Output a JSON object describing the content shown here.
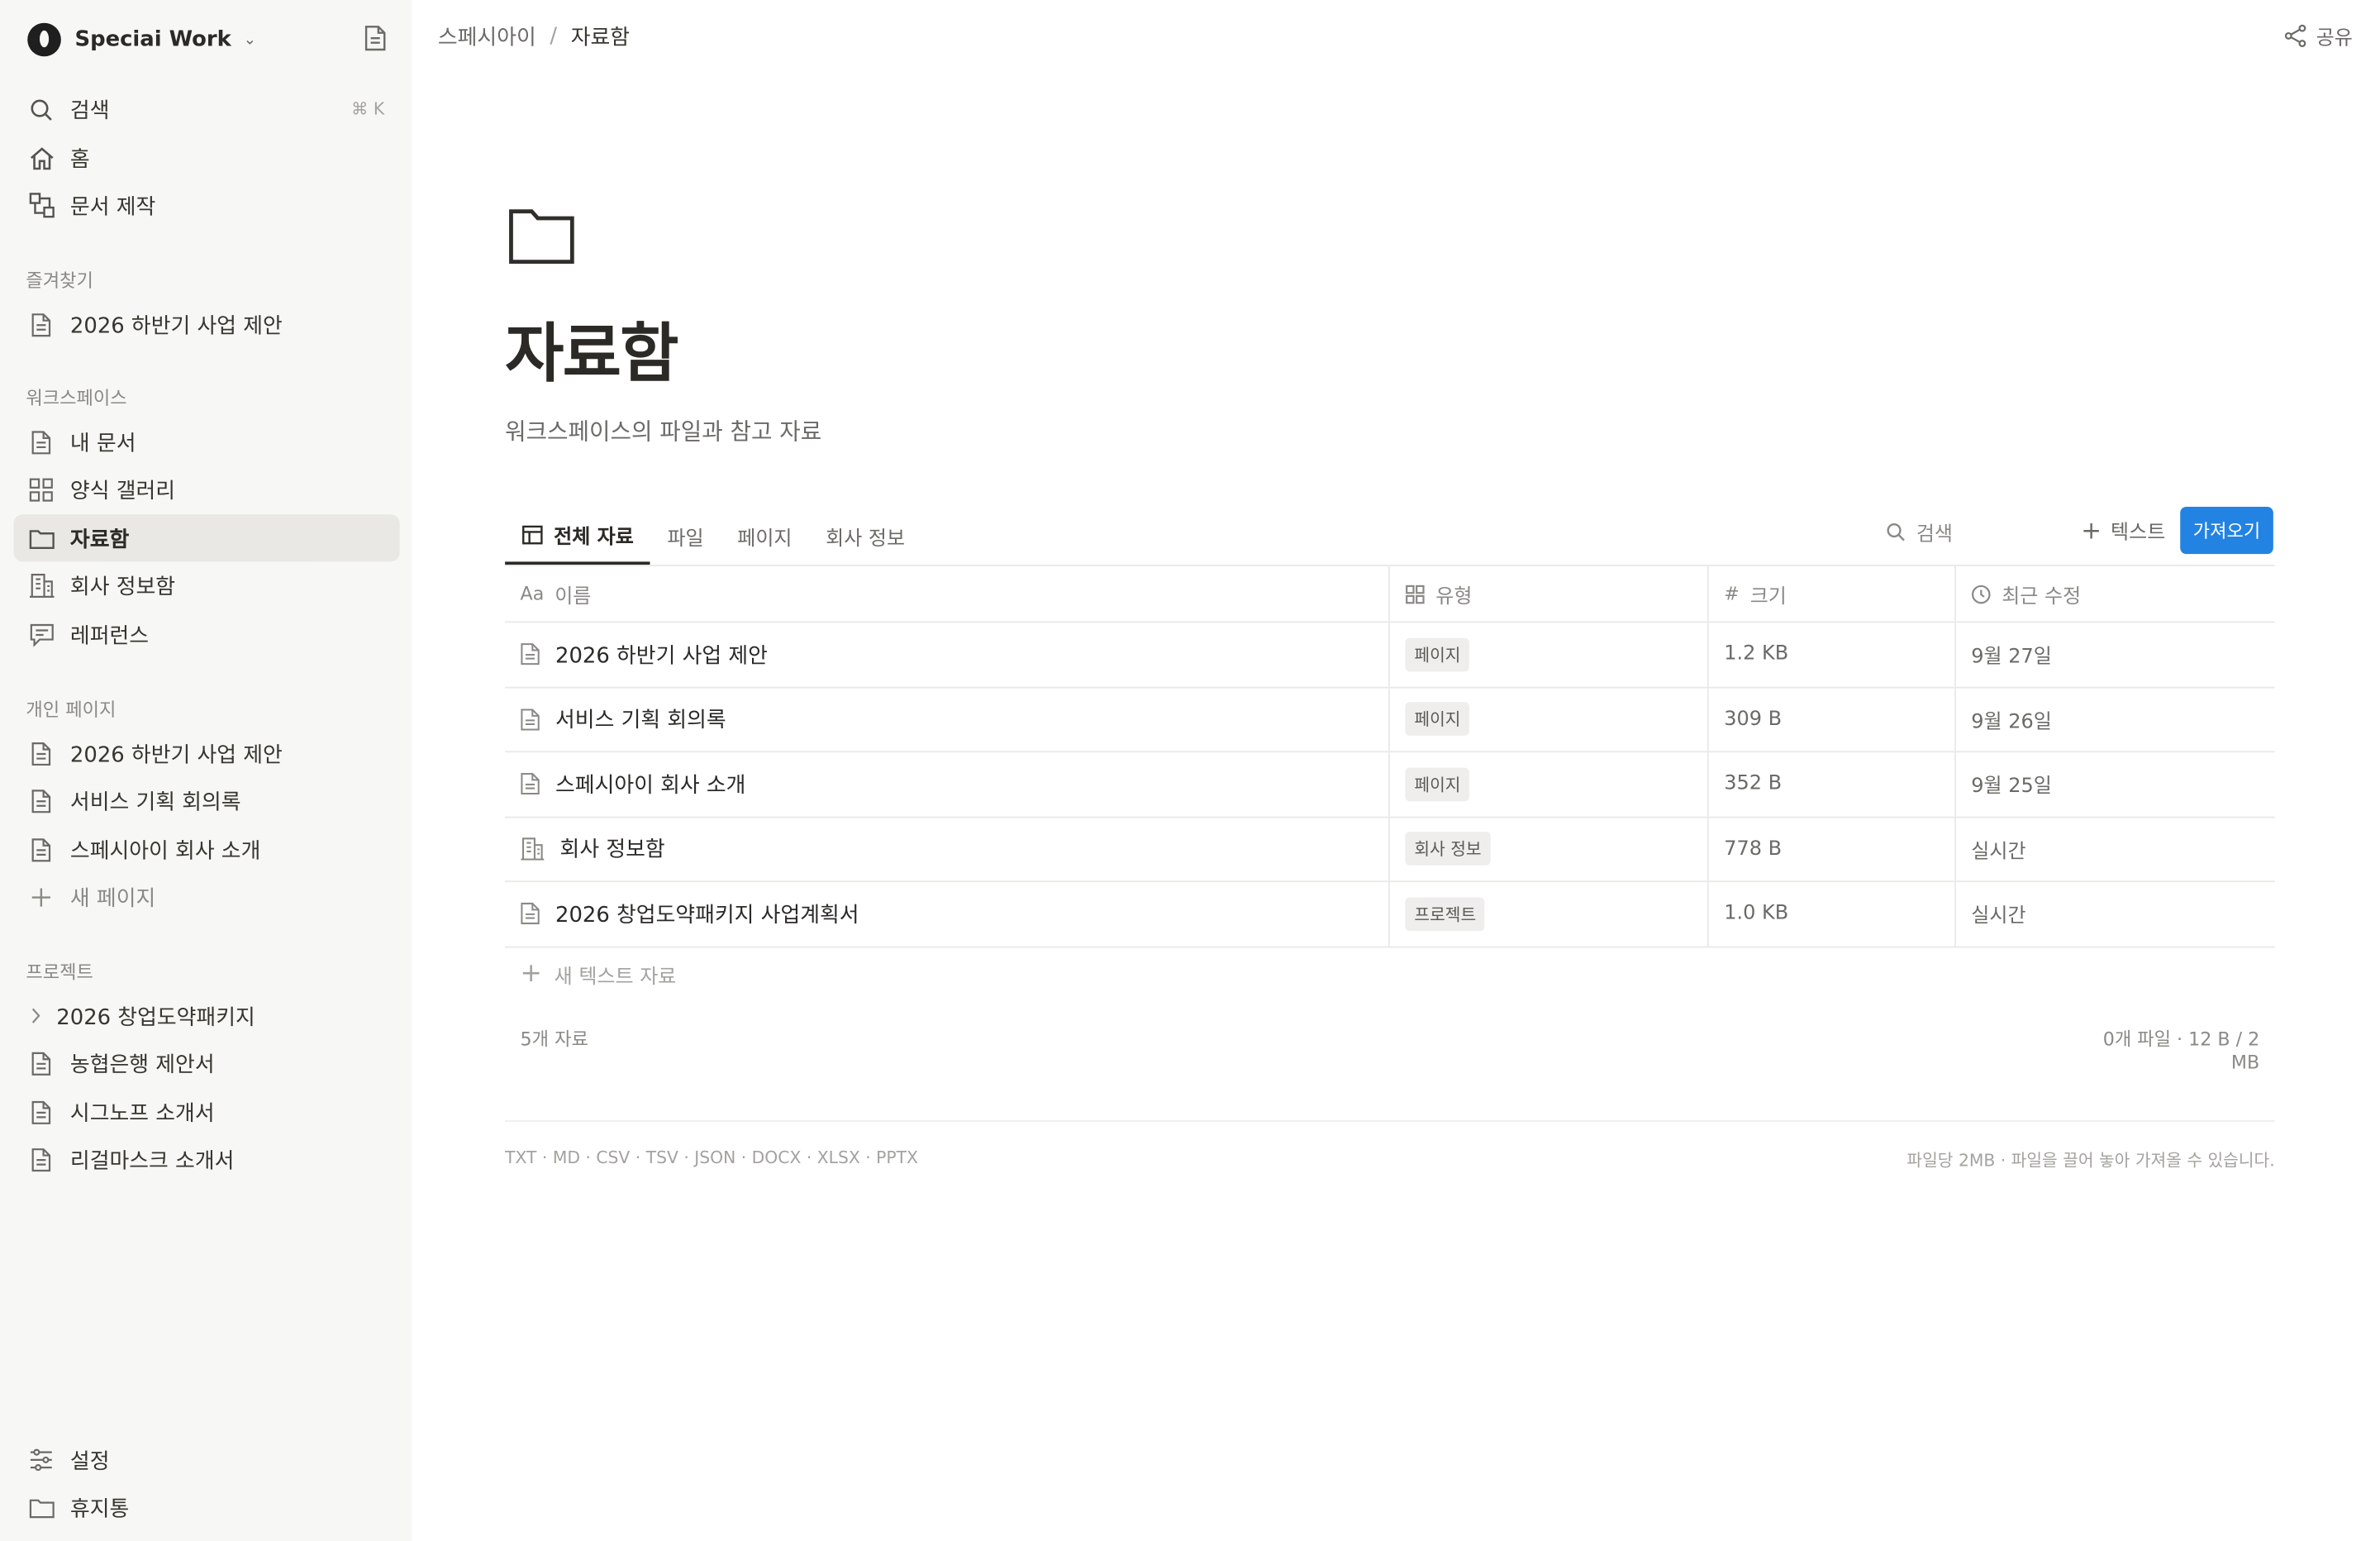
{
  "workspace": {
    "name": "Speciai Work"
  },
  "sidebar": {
    "search": {
      "label": "검색",
      "shortcut": "⌘ K"
    },
    "home": "홈",
    "docgen": "문서 제작",
    "favorites": {
      "label": "즐겨찾기",
      "items": [
        "2026 하반기 사업 제안"
      ]
    },
    "workspace_section": {
      "label": "워크스페이스",
      "items": [
        "내 문서",
        "양식 갤러리",
        "자료함",
        "회사 정보함",
        "레퍼런스"
      ]
    },
    "personal": {
      "label": "개인 페이지",
      "items": [
        "2026 하반기 사업 제안",
        "서비스 기획 회의록",
        "스페시아이 회사 소개"
      ],
      "new_page": "새 페이지"
    },
    "projects": {
      "label": "프로젝트",
      "items": [
        "2026 창업도약패키지",
        "농협은행 제안서",
        "시그노프 소개서",
        "리걸마스크 소개서"
      ]
    },
    "settings": "설정",
    "trash": "휴지통"
  },
  "breadcrumb": {
    "parent": "스페시아이",
    "separator": "/",
    "current": "자료함"
  },
  "share_label": "공유",
  "page": {
    "title": "자료함",
    "description": "워크스페이스의 파일과 참고 자료"
  },
  "tabs": [
    "전체 자료",
    "파일",
    "페이지",
    "회사 정보"
  ],
  "toolbar": {
    "search_placeholder": "검색",
    "text_label": "텍스트",
    "import_label": "가져오기"
  },
  "table": {
    "headers": {
      "name_icon": "Aa",
      "name": "이름",
      "type": "유형",
      "size_icon": "#",
      "size": "크기",
      "modified": "최근 수정"
    },
    "rows": [
      {
        "icon": "page-icon",
        "name": "2026 하반기 사업 제안",
        "type": "페이지",
        "size": "1.2 KB",
        "modified": "9월 27일"
      },
      {
        "icon": "page-icon",
        "name": "서비스 기획 회의록",
        "type": "페이지",
        "size": "309 B",
        "modified": "9월 26일"
      },
      {
        "icon": "page-icon",
        "name": "스페시아이 회사 소개",
        "type": "페이지",
        "size": "352 B",
        "modified": "9월 25일"
      },
      {
        "icon": "building-icon",
        "name": "회사 정보함",
        "type": "회사 정보",
        "size": "778 B",
        "modified": "실시간"
      },
      {
        "icon": "page-icon",
        "name": "2026 창업도약패키지 사업계획서",
        "type": "프로젝트",
        "size": "1.0 KB",
        "modified": "실시간"
      }
    ],
    "new_row": "새 텍스트 자료"
  },
  "footer": {
    "count": "5개 자료",
    "files": "0개 파일 · 12 B / 2 MB",
    "formats": "TXT · MD · CSV · TSV · JSON · DOCX · XLSX · PPTX",
    "limits": "파일당 2MB · 파일을 끌어 놓아 가져올 수 있습니다."
  }
}
